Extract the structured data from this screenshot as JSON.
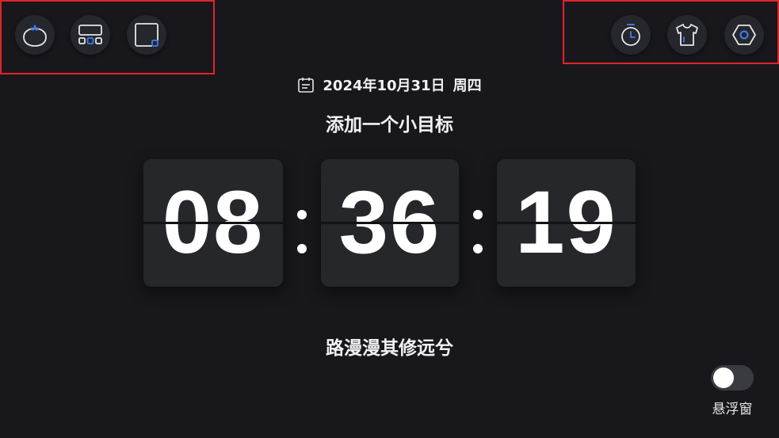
{
  "date": {
    "text": "2024年10月31日",
    "weekday": "周四"
  },
  "goal": {
    "placeholder": "添加一个小目标"
  },
  "clock": {
    "hours": "08",
    "minutes": "36",
    "seconds": "19"
  },
  "motto": "路漫漫其修远兮",
  "floating_window": {
    "label": "悬浮窗",
    "enabled": false
  },
  "toolbar_left": [
    {
      "icon": "tomato-icon"
    },
    {
      "icon": "layout-icon"
    },
    {
      "icon": "window-icon"
    }
  ],
  "toolbar_right": [
    {
      "icon": "stopwatch-icon"
    },
    {
      "icon": "shirt-icon"
    },
    {
      "icon": "settings-hexagon-icon"
    }
  ],
  "colors": {
    "background": "#18181c",
    "card": "#26272b",
    "accent": "#3d7ef5",
    "text": "#f2f2f2",
    "highlight": "#e0242b"
  }
}
